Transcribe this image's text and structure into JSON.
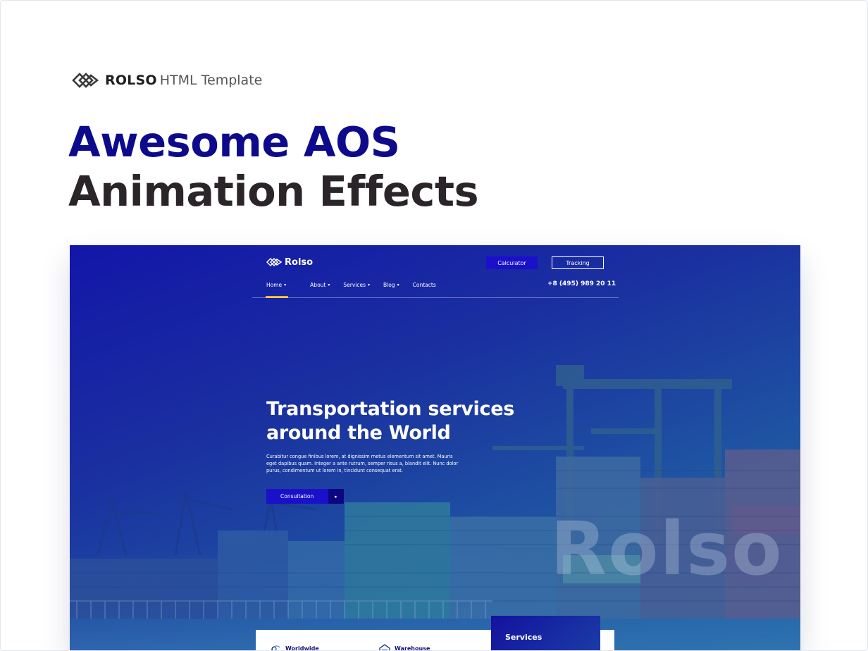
{
  "promo": {
    "brand_name": "ROLSO",
    "brand_suffix": "HTML Template",
    "headline_line1": "Awesome AOS",
    "headline_line2": "Animation Effects"
  },
  "preview": {
    "logo_text": "Rolso",
    "calculator_label": "Calculator",
    "tracking_label": "Tracking",
    "nav": [
      {
        "label": "Home",
        "has_caret": true,
        "active": true
      },
      {
        "label": "About",
        "has_caret": true
      },
      {
        "label": "Services",
        "has_caret": true
      },
      {
        "label": "Blog",
        "has_caret": true
      },
      {
        "label": "Contacts",
        "has_caret": false
      }
    ],
    "caret": "▾",
    "phone": "+8 (495) 989 20 11",
    "hero_title_line1": "Transportation services",
    "hero_title_line2": "around the World",
    "hero_text_line1": "Curabitur congue finibus lorem, at dignissim metus elementum sit amet. Mauris",
    "hero_text_line2": "eget dapibus quam. Integer a ante rutrum, semper risus a, blandit elit. Nunc dolor",
    "hero_text_line3": "purus, condimentum ut lorem in, tincidunt consequat erat.",
    "consultation_label": "Consultation",
    "consultation_arrow": "▸",
    "watermark": "Rolso",
    "card_items": [
      "Worldwide",
      "Warehouse"
    ],
    "services_label": "Services"
  },
  "colors": {
    "headline_blue": "#0d0b8c",
    "headline_dark": "#2b2529",
    "button_blue": "#1a10c9",
    "active_underline": "#f3b71a"
  }
}
